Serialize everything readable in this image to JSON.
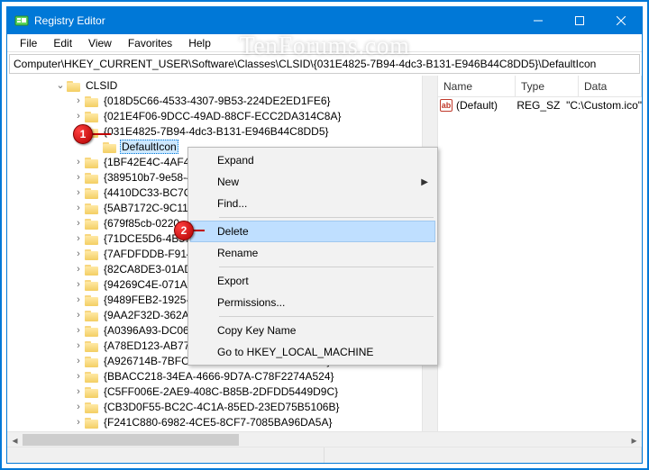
{
  "watermark": "TenForums.com",
  "title": "Registry Editor",
  "menus": [
    "File",
    "Edit",
    "View",
    "Favorites",
    "Help"
  ],
  "address": "Computer\\HKEY_CURRENT_USER\\Software\\Classes\\CLSID\\{031E4825-7B94-4dc3-B131-E946B44C8DD5}\\DefaultIcon",
  "tree": {
    "root": "CLSID",
    "selected_key": "DefaultIcon",
    "parent_open": "{031E4825-7B94-4dc3-B131-E946B44C8DD5}",
    "siblings": [
      "{018D5C66-4533-4307-9B53-224DE2ED1FE6}",
      "{021E4F06-9DCC-49AD-88CF-ECC2DA314C8A}",
      "{031E4825-7B94-4dc3-B131-E946B44C8DD5}",
      "{1BF42E4C-4AF4-4",
      "{389510b7-9e58-4",
      "{4410DC33-BC7C-4",
      "{5AB7172C-9C11-",
      "{679f85cb-0220",
      "{71DCE5D6-4B57-",
      "{7AFDFDDB-F914-",
      "{82CA8DE3-01AD",
      "{94269C4E-071A-4",
      "{9489FEB2-1925-4",
      "{9AA2F32D-362A-",
      "{A0396A93-DC06-",
      "{A78ED123-AB77-406B-9962-2A5D9D2F7F30}",
      "{A926714B-7BFC-4D08-A035-80021395BF2D}",
      "{BBACC218-34EA-4666-9D7A-C78F2274A524}",
      "{C5FF006E-2AE9-408C-B85B-2DFDD5449D9C}",
      "{CB3D0F55-BC2C-4C1A-85ED-23ED75B5106B}",
      "{F241C880-6982-4CE5-8CF7-7085BA96DA5A}"
    ]
  },
  "list": {
    "cols": [
      "Name",
      "Type",
      "Data"
    ],
    "row": {
      "name": "(Default)",
      "type": "REG_SZ",
      "data": "\"C:\\Custom.ico\""
    }
  },
  "context_menu": {
    "items": [
      {
        "label": "Expand",
        "sep_after": false,
        "sub": false
      },
      {
        "label": "New",
        "sep_after": false,
        "sub": true
      },
      {
        "label": "Find...",
        "sep_after": true,
        "sub": false
      },
      {
        "label": "Delete",
        "sep_after": false,
        "sub": false,
        "hover": true
      },
      {
        "label": "Rename",
        "sep_after": true,
        "sub": false
      },
      {
        "label": "Export",
        "sep_after": false,
        "sub": false
      },
      {
        "label": "Permissions...",
        "sep_after": true,
        "sub": false
      },
      {
        "label": "Copy Key Name",
        "sep_after": false,
        "sub": false
      },
      {
        "label": "Go to HKEY_LOCAL_MACHINE",
        "sep_after": false,
        "sub": false
      }
    ]
  },
  "annotations": {
    "dot1": "1",
    "dot2": "2"
  }
}
